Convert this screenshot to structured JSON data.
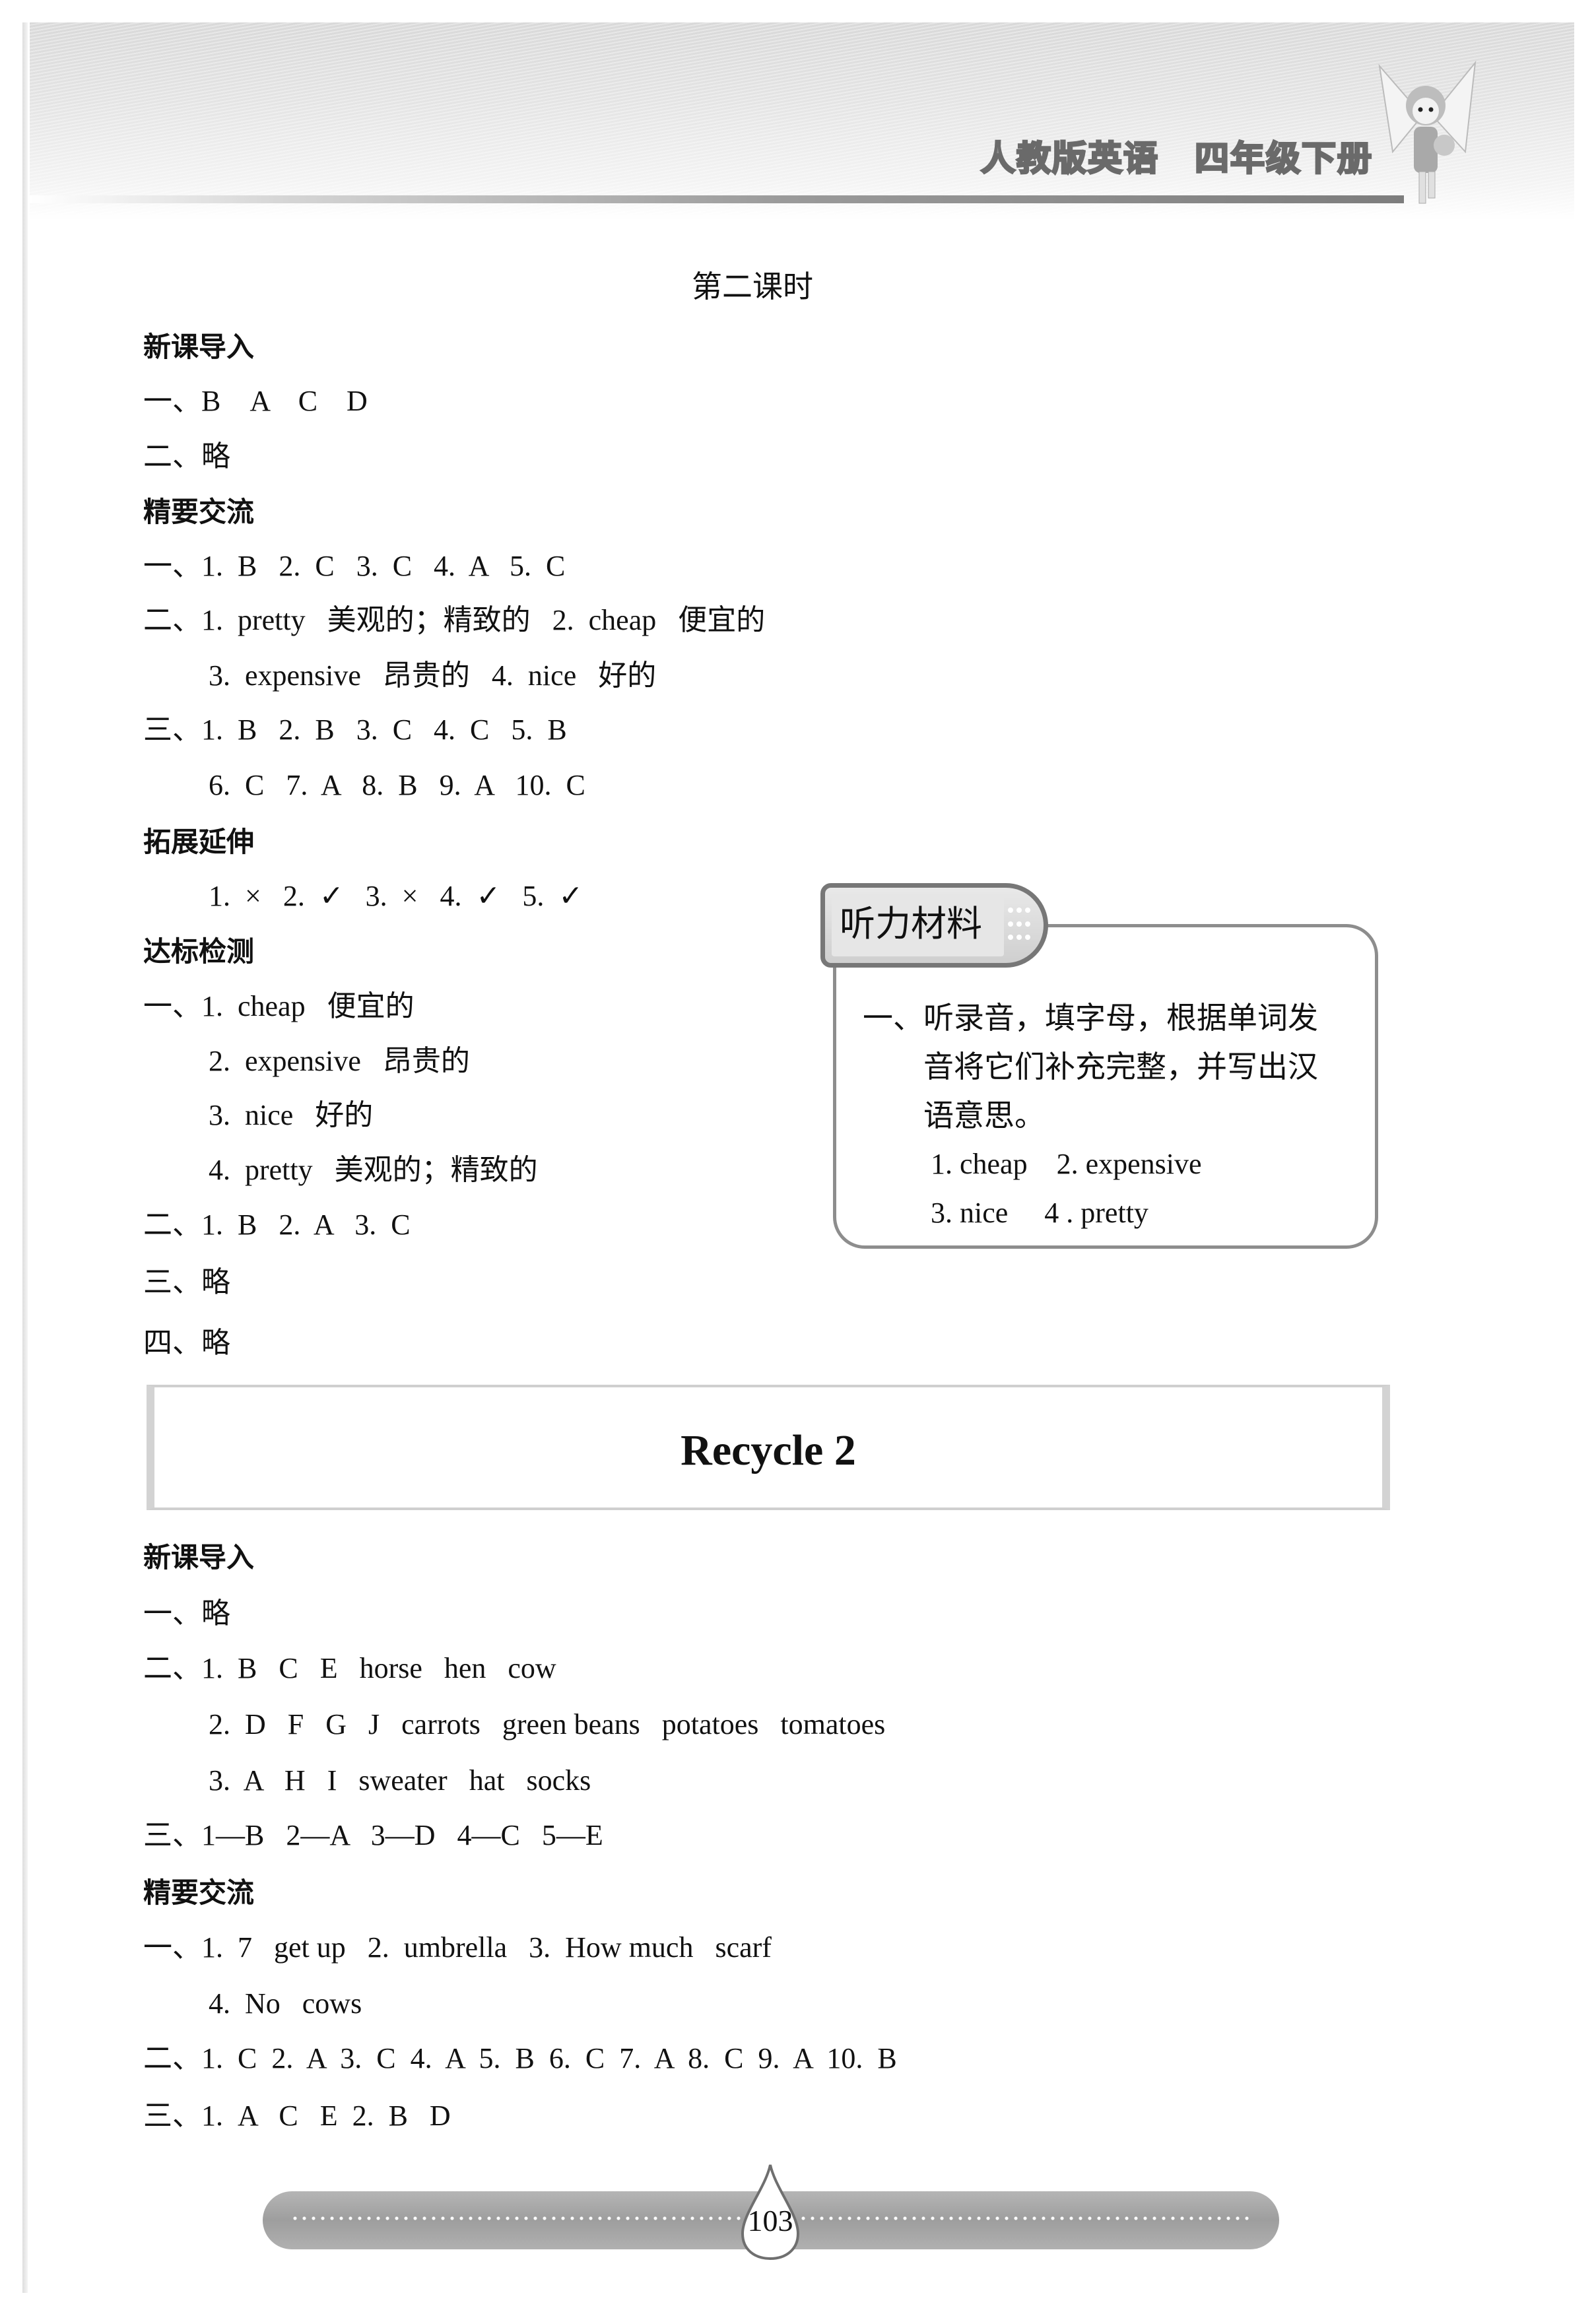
{
  "header": {
    "book_title": "人教版英语　四年级下册",
    "illustration": "fairy-with-teddy-bear"
  },
  "lesson2": {
    "title": "第二课时",
    "sections": [
      {
        "heading": "新课导入",
        "lines": [
          {
            "indent": 0,
            "text": "一、B　A　C　D"
          },
          {
            "indent": 0,
            "text": "二、略"
          }
        ]
      },
      {
        "heading": "精要交流",
        "lines": [
          {
            "indent": 0,
            "text": "一、1.  B   2.  C   3.  C   4.  A   5.  C"
          },
          {
            "indent": 0,
            "text": "二、1.  pretty   美观的；精致的   2.  cheap   便宜的"
          },
          {
            "indent": 1,
            "text": "3.  expensive   昂贵的   4.  nice   好的"
          },
          {
            "indent": 0,
            "text": "三、1.  B   2.  B   3.  C   4.  C   5.  B"
          },
          {
            "indent": 1,
            "text": "6.  C   7.  A   8.  B   9.  A   10.  C"
          }
        ]
      },
      {
        "heading": "拓展延伸",
        "lines": [
          {
            "indent": 1,
            "text": "1.  ×   2.  ✓   3.  ×   4.  ✓   5.  ✓"
          }
        ]
      },
      {
        "heading": "达标检测",
        "lines": [
          {
            "indent": 0,
            "text": "一、1.  cheap   便宜的"
          },
          {
            "indent": 1,
            "text": "2.  expensive   昂贵的"
          },
          {
            "indent": 1,
            "text": "3.  nice   好的"
          },
          {
            "indent": 1,
            "text": "4.  pretty   美观的；精致的"
          },
          {
            "indent": 0,
            "text": "二、1.  B   2.  A   3.  C"
          },
          {
            "indent": 0,
            "text": "三、略"
          },
          {
            "indent": 0,
            "text": "四、略"
          }
        ]
      }
    ]
  },
  "listening": {
    "label": "听力材料",
    "instruction_lines": [
      "一、听录音，填字母，根据单词发",
      "　　音将它们补充完整，并写出汉",
      "　　语意思。"
    ],
    "words_lines": [
      "1. cheap    2. expensive",
      "3. nice     4 . pretty"
    ]
  },
  "recycle2": {
    "title": "Recycle 2",
    "sections": [
      {
        "heading": "新课导入",
        "lines": [
          {
            "indent": 0,
            "text": "一、略"
          },
          {
            "indent": 0,
            "text": "二、1.  B   C   E   horse   hen   cow"
          },
          {
            "indent": 1,
            "text": "2.  D   F   G   J   carrots   green beans   potatoes   tomatoes"
          },
          {
            "indent": 1,
            "text": "3.  A   H   I   sweater   hat   socks"
          },
          {
            "indent": 0,
            "text": "三、1—B   2—A   3—D   4—C   5—E"
          }
        ]
      },
      {
        "heading": "精要交流",
        "lines": [
          {
            "indent": 0,
            "text": "一、1.  7   get up   2.  umbrella   3.  How much   scarf"
          },
          {
            "indent": 1,
            "text": "4.  No   cows"
          },
          {
            "indent": 0,
            "text": "二、1.  C  2.  A  3.  C  4.  A  5.  B  6.  C  7.  A  8.  C  9.  A  10.  B"
          },
          {
            "indent": 0,
            "text": "三、1.  A   C   E  2.  B   D"
          }
        ]
      }
    ]
  },
  "footer": {
    "page_number": "103"
  }
}
